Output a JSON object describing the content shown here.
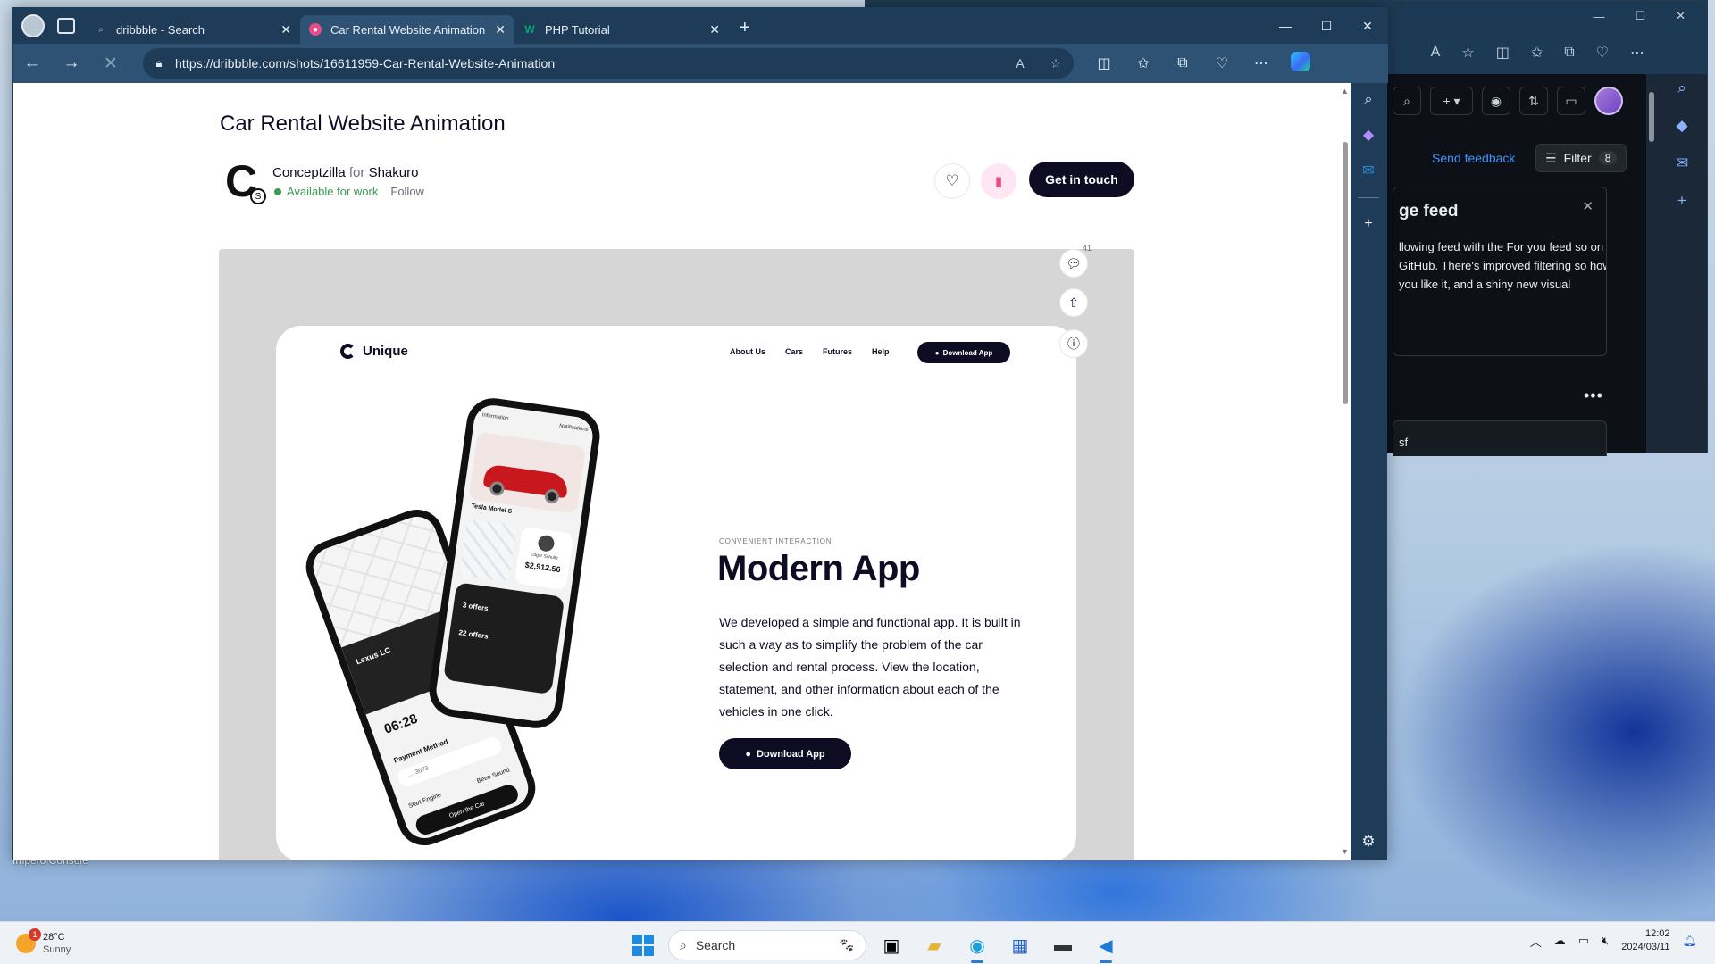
{
  "desktop": {
    "icon_label": "Impero Console",
    "accent": "#1e3b57"
  },
  "github_window": {
    "send_feedback": "Send feedback",
    "filter_label": "Filter",
    "filter_count": "8",
    "feed_card_title": "ge feed",
    "feed_card_text": "llowing feed with the For you feed so on GitHub. There's improved filtering so how you like it, and a shiny new visual",
    "item_text": "sf"
  },
  "browser": {
    "tabs": [
      {
        "label": "dribbble - Search",
        "icon": "search-icon"
      },
      {
        "label": "Car Rental Website Animation by",
        "icon": "dribbble-icon"
      },
      {
        "label": "PHP Tutorial",
        "icon": "w3schools-icon"
      }
    ],
    "url": "https://dribbble.com/shots/16611959-Car-Rental-Website-Animation"
  },
  "page": {
    "title": "Car Rental Website Animation",
    "author": "Conceptzilla",
    "for_word": "for",
    "team": "Shakuro",
    "availability": "Available for work",
    "follow": "Follow",
    "get_in_touch": "Get in touch",
    "comments_count": "41"
  },
  "shot": {
    "brand": "Unique",
    "nav": [
      "About Us",
      "Cars",
      "Futures",
      "Help"
    ],
    "download_small": "Download App",
    "eyebrow": "CONVENIENT INTERACTION",
    "headline": "Modern App",
    "body": "We developed a simple and functional app. It is built in such a way as to simplify the problem of the car selection and rental process. View the location, statement, and other information about each of the vehicles in one click.",
    "download_big": "Download App",
    "phone1": {
      "car": "Lexus LC",
      "time": "06:28",
      "payment": "Payment Method",
      "card": ".... 3673",
      "start_engine": "Start Engine",
      "beep_sound": "Beep Sound",
      "open": "Open the Car"
    },
    "phone2": {
      "tab_info": "Information",
      "tab_notif": "Notifications",
      "car": "Tesla Model S",
      "person": "Edgar Schultz",
      "price": "$2,912.56",
      "offers1": "3 offers",
      "offers2": "22 offers"
    }
  },
  "taskbar": {
    "temp": "28°C",
    "condition": "Sunny",
    "weather_badge": "1",
    "search_placeholder": "Search",
    "time": "12:02",
    "date": "2024/03/11"
  }
}
